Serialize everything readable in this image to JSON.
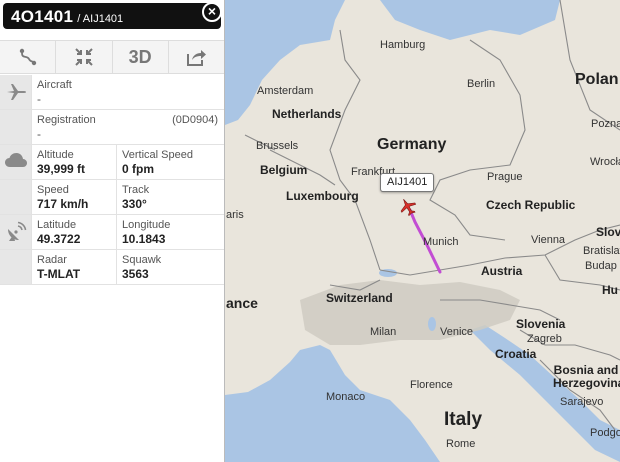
{
  "header": {
    "flight": "4O1401",
    "callsign": "/ AIJ1401"
  },
  "toolbar": {
    "buttons": [
      {
        "name": "route",
        "icon": "route-icon"
      },
      {
        "name": "collapse",
        "icon": "compress-arrows-icon"
      },
      {
        "name": "3d",
        "label": "3D"
      },
      {
        "name": "share",
        "icon": "share-icon"
      }
    ]
  },
  "aircraft": {
    "aircraft_label": "Aircraft",
    "aircraft_value": "-",
    "registration_label": "Registration",
    "registration_value": "-",
    "mode_s": "(0D0904)"
  },
  "flight_data": {
    "altitude_label": "Altitude",
    "altitude_value": "39,999 ft",
    "vspeed_label": "Vertical Speed",
    "vspeed_value": "0 fpm",
    "speed_label": "Speed",
    "speed_value": "717 km/h",
    "track_label": "Track",
    "track_value": "330°",
    "latitude_label": "Latitude",
    "latitude_value": "49.3722",
    "longitude_label": "Longitude",
    "longitude_value": "10.1843",
    "radar_label": "Radar",
    "radar_value": "T-MLAT",
    "squawk_label": "Squawk",
    "squawk_value": "3563"
  },
  "map": {
    "plane_label": "AIJ1401",
    "countries": {
      "germany": "Germany",
      "netherlands": "Netherlands",
      "belgium": "Belgium",
      "luxembourg": "Luxembourg",
      "czech": "Czech Republic",
      "austria": "Austria",
      "switzerland": "Switzerland",
      "slovenia": "Slovenia",
      "croatia": "Croatia",
      "bosnia": "Bosnia and Herzegovina",
      "italy": "Italy",
      "monaco": "Monaco",
      "poland_partial": "Polan",
      "france_partial": "ance",
      "slovakia_partial": "Slova",
      "hungary_partial": "Hu"
    },
    "cities": {
      "hamburg": "Hamburg",
      "berlin": "Berlin",
      "amsterdam": "Amsterdam",
      "brussels": "Brussels",
      "frankfurt": "Frankfurt",
      "prague": "Prague",
      "munich": "Munich",
      "vienna": "Vienna",
      "milan": "Milan",
      "venice": "Venice",
      "zagreb": "Zagreb",
      "florence": "Florence",
      "rome": "Rome",
      "sarajevo": "Sarajevo",
      "bratislava": "Bratislava",
      "budapest": "Budap",
      "paris_partial": "aris",
      "poznan": "Poznań",
      "wroclaw": "Wrocław",
      "podgorica_partial": "Podgo"
    },
    "colors": {
      "land": "#e9e5dc",
      "water": "#aac5e4",
      "track": "#c24dd3",
      "plane": "#d9302b"
    }
  }
}
